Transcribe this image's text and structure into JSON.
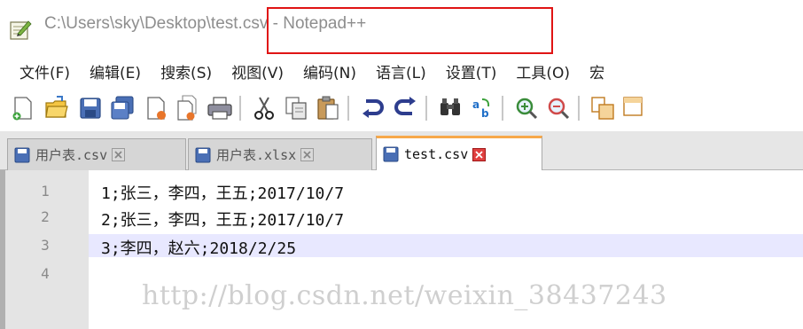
{
  "window": {
    "title": "C:\\Users\\sky\\Desktop\\test.csv - Notepad++",
    "app_icon": "notepad-plus-plus-icon"
  },
  "menu": [
    {
      "label": "文件(F)"
    },
    {
      "label": "编辑(E)"
    },
    {
      "label": "搜索(S)"
    },
    {
      "label": "视图(V)"
    },
    {
      "label": "编码(N)"
    },
    {
      "label": "语言(L)"
    },
    {
      "label": "设置(T)"
    },
    {
      "label": "工具(O)"
    },
    {
      "label": "宏"
    }
  ],
  "toolbar": {
    "icons": [
      "new-file-icon",
      "open-file-icon",
      "save-icon",
      "save-all-icon",
      "close-icon",
      "close-all-icon",
      "print-icon",
      "cut-icon",
      "copy-icon",
      "paste-icon",
      "undo-icon",
      "redo-icon",
      "find-icon",
      "replace-icon",
      "zoom-in-icon",
      "zoom-out-icon",
      "sync-vertical-icon",
      "sync-horizontal-icon"
    ]
  },
  "tabs": [
    {
      "label": "用户表.csv",
      "active": false
    },
    {
      "label": "用户表.xlsx",
      "active": false
    },
    {
      "label": "test.csv",
      "active": true
    }
  ],
  "editor": {
    "lines": [
      {
        "number": "1",
        "text": "1;张三，李四，王五;2017/10/7"
      },
      {
        "number": "2",
        "text": "2;张三，李四，王五;2017/10/7"
      },
      {
        "number": "3",
        "text": "3;李四，赵六;2018/2/25"
      },
      {
        "number": "4",
        "text": ""
      }
    ],
    "current_line": 3
  },
  "watermark": "http://blog.csdn.net/weixin_38437243",
  "colors": {
    "highlight_box": "#e01414",
    "active_tab_accent": "#f7a84a",
    "current_line": "#e8e8ff"
  }
}
